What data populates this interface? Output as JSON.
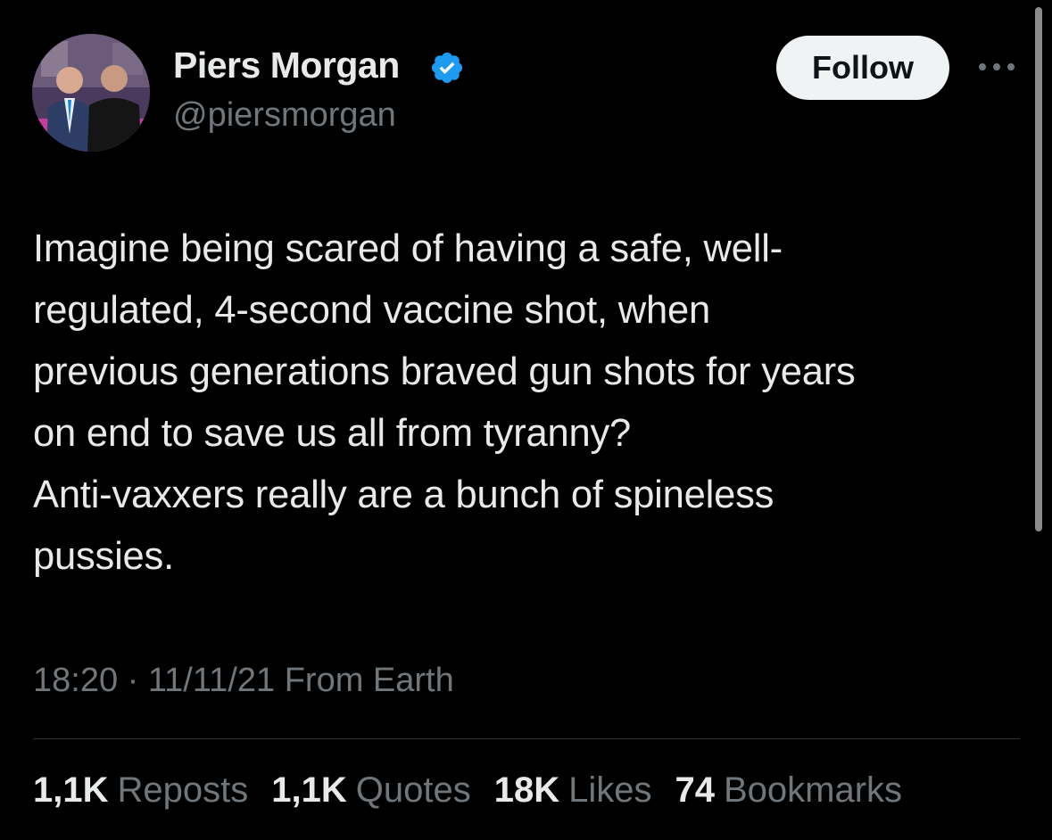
{
  "author": {
    "display_name": "Piers Morgan",
    "handle": "@piersmorgan",
    "verified": true,
    "avatar_icon": "profile-photo-icon"
  },
  "actions": {
    "follow_label": "Follow",
    "more_icon": "more-options-icon"
  },
  "tweet": {
    "lines": [
      "Imagine being scared of having a safe, well-",
      "regulated, 4-second vaccine shot, when",
      "previous generations braved gun shots for years",
      "on end to save us all from tyranny?",
      "Anti-vaxxers really are a bunch of spineless",
      "pussies."
    ],
    "meta": "18:20 · 11/11/21 From Earth"
  },
  "stats": [
    {
      "value": "1,1K",
      "label": "Reposts"
    },
    {
      "value": "1,1K",
      "label": "Quotes"
    },
    {
      "value": "18K",
      "label": "Likes"
    },
    {
      "value": "74",
      "label": "Bookmarks"
    }
  ],
  "colors": {
    "background": "#000000",
    "text_primary": "#e7e9ea",
    "text_secondary": "#71767b",
    "verified_blue": "#1d9bf0",
    "follow_bg": "#eff3f4"
  }
}
